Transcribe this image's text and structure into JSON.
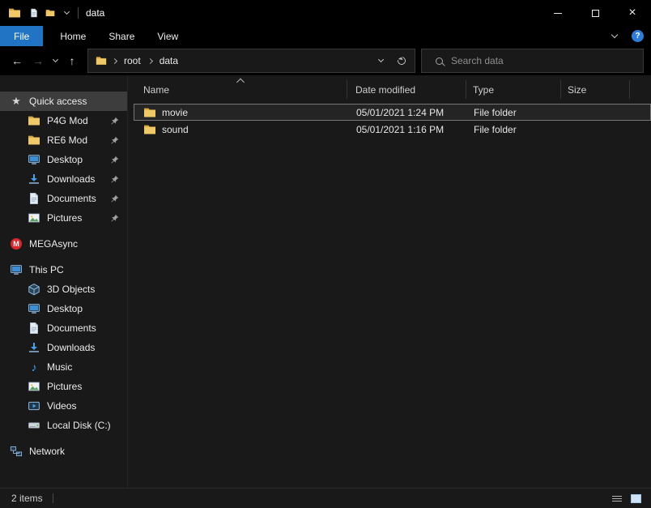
{
  "colors": {
    "chrome-bg": "#000000",
    "main-bg": "#191919",
    "accent": "#2173c4",
    "help-blue": "#2e7cd6",
    "text": "#e9e9e9",
    "selected-border": "#767676",
    "sidebar-selected": "#3d3d3d",
    "folder-yellow": "#efc868"
  },
  "titlebar": {
    "title": "data"
  },
  "ribbon": {
    "tabs": [
      {
        "label": "File"
      },
      {
        "label": "Home"
      },
      {
        "label": "Share"
      },
      {
        "label": "View"
      }
    ]
  },
  "navbar": {
    "breadcrumb": {
      "root": "root",
      "current": "data"
    },
    "search": {
      "placeholder": "Search data"
    }
  },
  "sidebar": {
    "items": [
      {
        "label": "Quick access"
      },
      {
        "label": "P4G Mod"
      },
      {
        "label": "RE6 Mod"
      },
      {
        "label": "Desktop"
      },
      {
        "label": "Downloads"
      },
      {
        "label": "Documents"
      },
      {
        "label": "Pictures"
      },
      {
        "label": "MEGAsync"
      },
      {
        "label": "This PC"
      },
      {
        "label": "3D Objects"
      },
      {
        "label": "Desktop"
      },
      {
        "label": "Documents"
      },
      {
        "label": "Downloads"
      },
      {
        "label": "Music"
      },
      {
        "label": "Pictures"
      },
      {
        "label": "Videos"
      },
      {
        "label": "Local Disk (C:)"
      },
      {
        "label": "Network"
      }
    ]
  },
  "file_list": {
    "columns": {
      "name": "Name",
      "date": "Date modified",
      "type": "Type",
      "size": "Size"
    },
    "rows": [
      {
        "name": "movie",
        "date": "05/01/2021 1:24 PM",
        "type": "File folder"
      },
      {
        "name": "sound",
        "date": "05/01/2021 1:16 PM",
        "type": "File folder"
      }
    ]
  },
  "statusbar": {
    "count": "2 items"
  },
  "icons": {
    "back_arrow": "←",
    "forward_arrow": "→",
    "up_arrow": "↑",
    "close": "×",
    "quick_access_star": "★",
    "music_note": "♪",
    "help": "?",
    "mega_m": "M"
  }
}
